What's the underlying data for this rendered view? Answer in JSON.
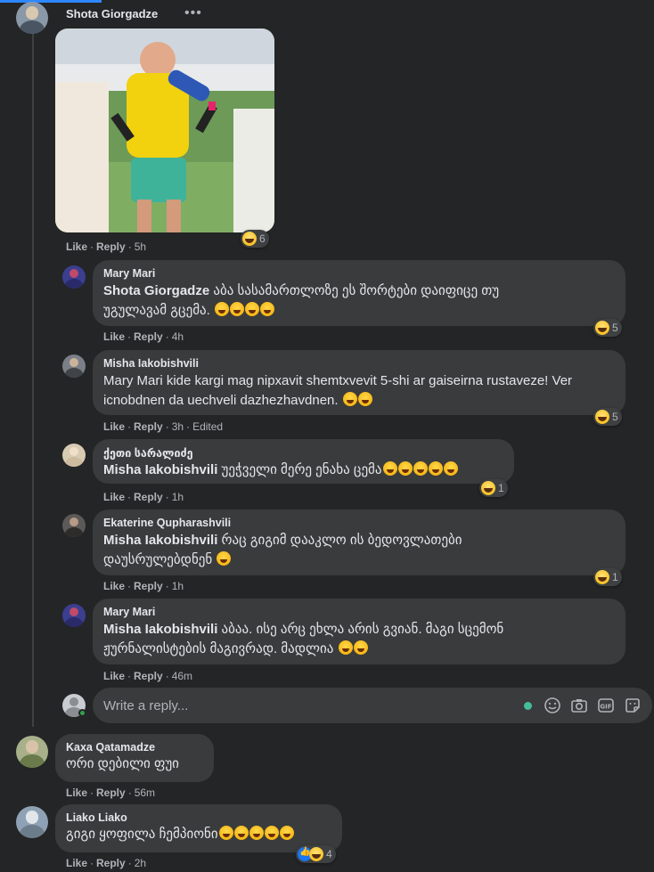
{
  "post": {
    "author": "Shota Giorgadze",
    "more": "•••",
    "actions": {
      "like": "Like",
      "reply": "Reply",
      "time": "5h"
    },
    "reactions": "6"
  },
  "comments": [
    {
      "name": "Mary Mari",
      "mention": "Shota Giorgadze",
      "text_line1": " აბა სასამართლოზე ეს შორტები დაიფიცე თუ",
      "text_line2": "უგულავამ გცემა.",
      "actions": {
        "like": "Like",
        "reply": "Reply",
        "time": "4h",
        "edited": ""
      },
      "reactions": "5"
    },
    {
      "name": "Misha Iakobishvili",
      "text_line1": "Mary Mari kide kargi mag nipxavit shemtxvevit 5-shi ar gaiseirna rustaveze! Ver",
      "text_line2": "icnobdnen da uechveli dazhezhavdnen.",
      "actions": {
        "like": "Like",
        "reply": "Reply",
        "time": "3h",
        "edited": "Edited"
      },
      "reactions": "5"
    },
    {
      "name": "ქეთი სარალიძე",
      "mention": "Misha Iakobishvili",
      "text_line1": " უეჭველი მერე ენახა ცემა",
      "actions": {
        "like": "Like",
        "reply": "Reply",
        "time": "1h"
      },
      "reactions": "1"
    },
    {
      "name": "Ekaterine Qupharashvili",
      "mention": "Misha Iakobishvili",
      "text_line1": " რაც გიგიმ დააკლო ის ბედოვლათები",
      "text_line2": "დაუსრულებდნენ",
      "actions": {
        "like": "Like",
        "reply": "Reply",
        "time": "1h"
      },
      "reactions": "1"
    },
    {
      "name": "Mary Mari",
      "mention": "Misha Iakobishvili",
      "text_line1": " აბაა. ისე არც ეხლა არის გვიან. მაგი სცემონ",
      "text_line2": "ჟურნალისტების მაგივრად. მადლია",
      "actions": {
        "like": "Like",
        "reply": "Reply",
        "time": "46m"
      }
    }
  ],
  "reply_box": {
    "placeholder": "Write a reply...",
    "icons": [
      "smiley-icon",
      "camera-icon",
      "gif-icon",
      "sticker-icon"
    ]
  },
  "top_comments": [
    {
      "name": "Kaxa Qatamadze",
      "text": "ორი დებილი ფუი",
      "actions": {
        "like": "Like",
        "reply": "Reply",
        "time": "56m"
      }
    },
    {
      "name": "Liako Liako",
      "text": "გიგი ყოფილა ჩემპიონი",
      "actions": {
        "like": "Like",
        "reply": "Reply",
        "time": "2h"
      },
      "reactions": "4"
    }
  ],
  "colors": {
    "background": "#242526",
    "bubble": "#3a3b3c",
    "text": "#e4e6eb",
    "secondary": "#b0b3b8",
    "accent": "#2d88ff"
  }
}
